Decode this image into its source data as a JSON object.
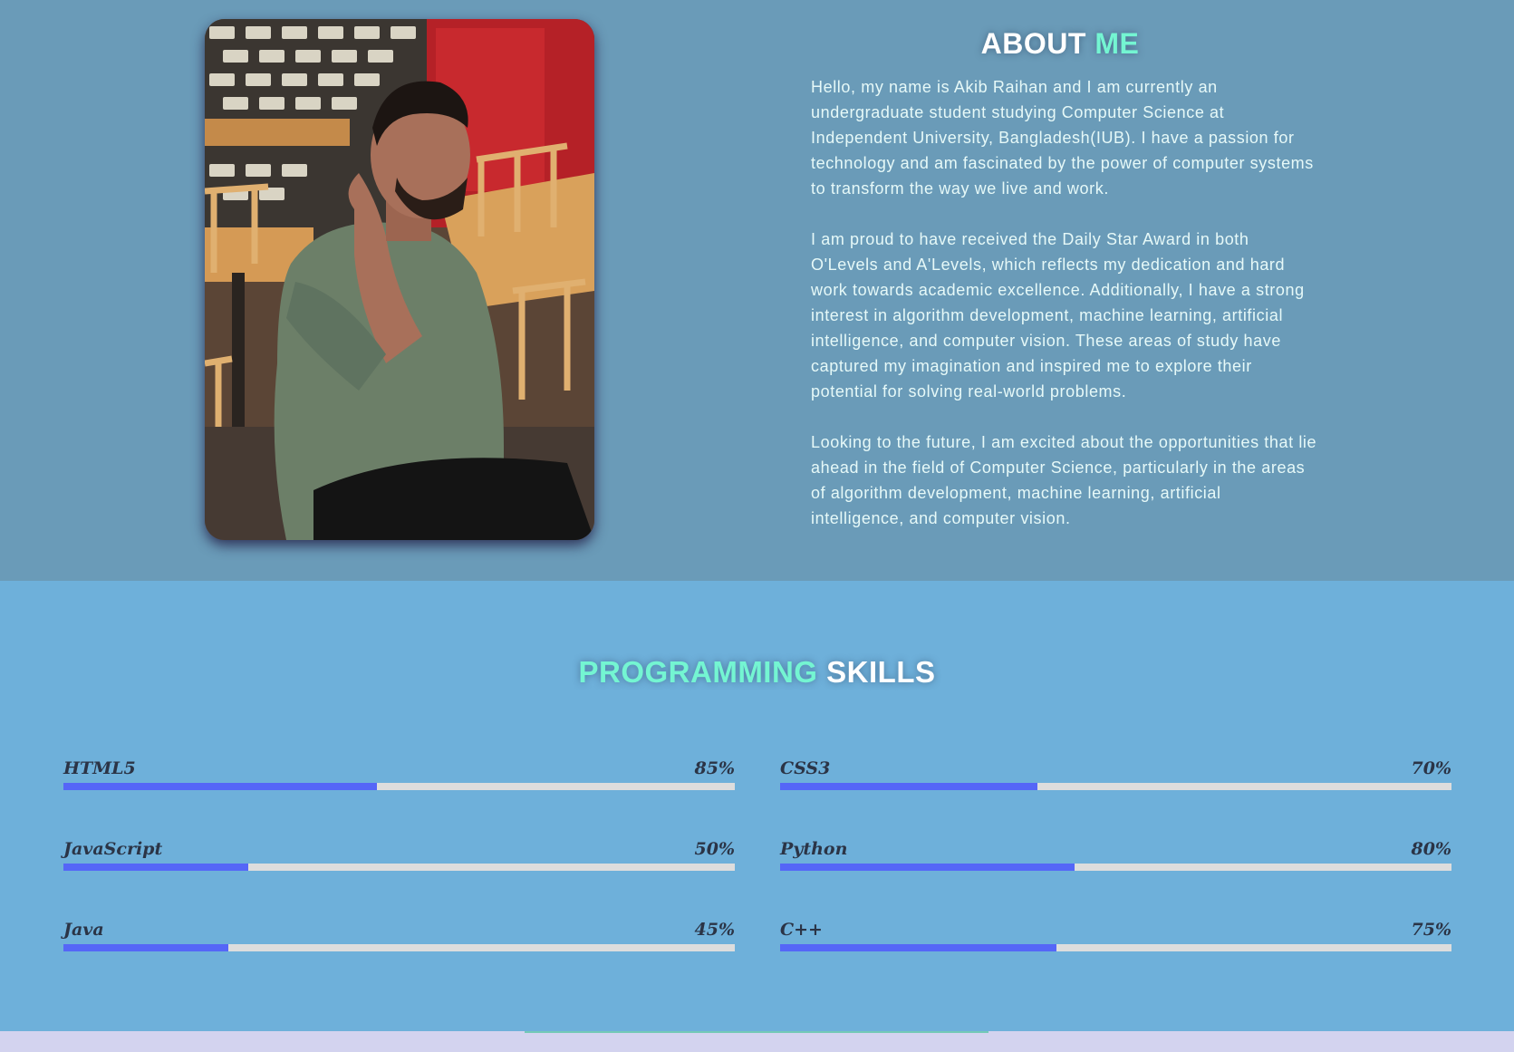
{
  "about": {
    "title_part1": "ABOUT",
    "title_part2": "ME",
    "paragraphs": [
      "Hello, my name is Akib Raihan and I am currently an undergraduate student studying Computer Science at Independent University, Bangladesh(IUB). I have a passion for technology and am fascinated by the power of computer systems to transform the way we live and work.",
      "I am proud to have received the Daily Star Award in both O'Levels and A'Levels, which reflects my dedication and hard work towards academic excellence. Additionally, I have a strong interest in algorithm development, machine learning, artificial intelligence, and computer vision. These areas of study have captured my imagination and inspired me to explore their potential for solving real-world problems.",
      "Looking to the future, I am excited about the opportunities that lie ahead in the field of Computer Science, particularly in the areas of algorithm development, machine learning, artificial intelligence, and computer vision."
    ]
  },
  "skills": {
    "title_part1": "PROGRAMMING",
    "title_part2": "SKILLS",
    "items": [
      {
        "name": "HTML5",
        "percent_label": "85%",
        "fill_fraction": 0.467
      },
      {
        "name": "CSS3",
        "percent_label": "70%",
        "fill_fraction": 0.383
      },
      {
        "name": "JavaScript",
        "percent_label": "50%",
        "fill_fraction": 0.275
      },
      {
        "name": "Python",
        "percent_label": "80%",
        "fill_fraction": 0.439
      },
      {
        "name": "Java",
        "percent_label": "45%",
        "fill_fraction": 0.246
      },
      {
        "name": "C++",
        "percent_label": "75%",
        "fill_fraction": 0.411
      }
    ]
  },
  "colors": {
    "about_bg": "#6a9bb8",
    "skills_bg": "#6eb0da",
    "accent_teal": "#74f5d2",
    "bar_fill": "#5566f7",
    "bar_track": "#dddddd"
  }
}
